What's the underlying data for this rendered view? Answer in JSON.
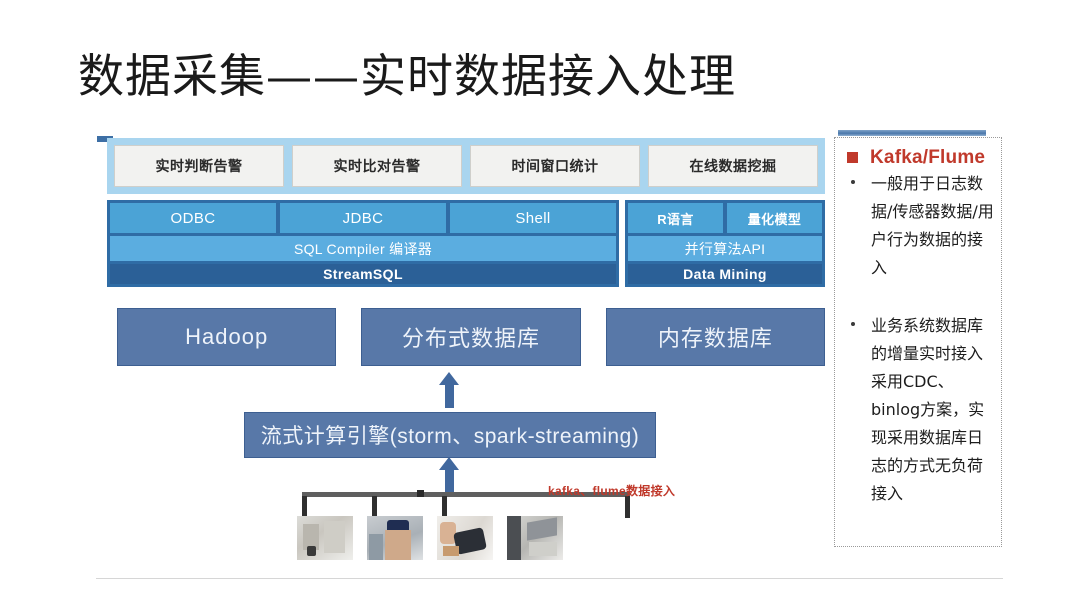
{
  "slide": {
    "title": "数据采集——实时数据接入处理"
  },
  "diagram": {
    "applications": [
      {
        "label": "实时判断告警"
      },
      {
        "label": "实时比对告警"
      },
      {
        "label": "时间窗口统计"
      },
      {
        "label": "在线数据挖掘"
      }
    ],
    "stream_block": {
      "interfaces": [
        {
          "label": "ODBC"
        },
        {
          "label": "JDBC"
        },
        {
          "label": "Shell"
        }
      ],
      "compiler": "SQL Compiler 编译器",
      "base": "StreamSQL"
    },
    "mining_block": {
      "interfaces": [
        {
          "label": "R语言"
        },
        {
          "label": "量化模型"
        }
      ],
      "compiler": "并行算法API",
      "base": "Data Mining"
    },
    "storage": [
      {
        "label": "Hadoop"
      },
      {
        "label": "分布式数据库"
      },
      {
        "label": "内存数据库"
      }
    ],
    "engine": "流式计算引擎(storm、spark-streaming)",
    "annotation": "kafka、flume数据接入",
    "sources": [
      {
        "name": "source-photo-industrial"
      },
      {
        "name": "source-photo-worker"
      },
      {
        "name": "source-photo-handheld"
      },
      {
        "name": "source-photo-facility"
      }
    ]
  },
  "sidebar": {
    "items": [
      {
        "bullet": "square",
        "heading": "Kafka/Flume",
        "text": "一般用于日志数据/传感器数据/用户行为数据的接入"
      },
      {
        "bullet": "dot",
        "heading": "",
        "text": "业务系统数据库的增量实时接入采用CDC、binlog方案，实现采用数据库日志的方式无负荷接入"
      }
    ]
  },
  "colors": {
    "app_band": "#a9d5ef",
    "interface_blue": "#4ba3d6",
    "compiler_blue": "#5bade0",
    "base_blue": "#2b6097",
    "frame_blue": "#2f6ca5",
    "storage_blue": "#5878a8",
    "accent_red": "#c0392b"
  }
}
